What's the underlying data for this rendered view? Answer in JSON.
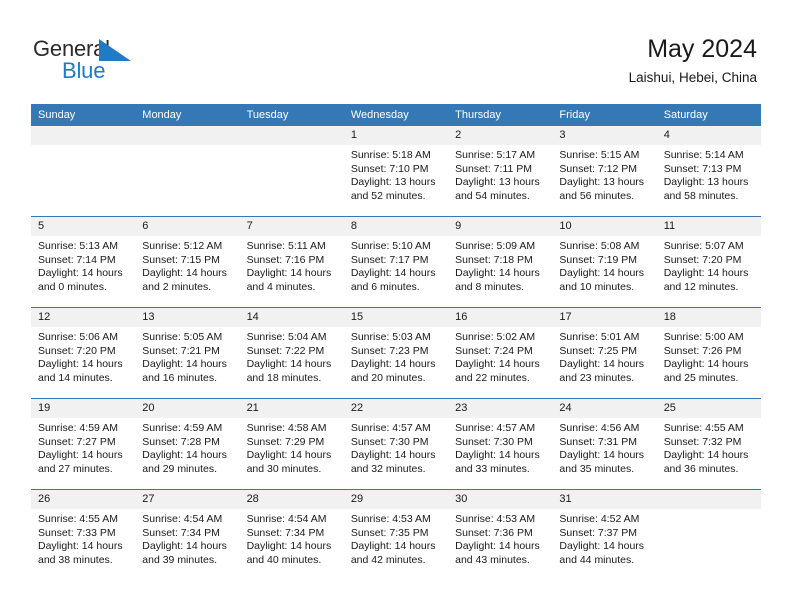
{
  "brand": {
    "name_part1": "General",
    "name_part2": "Blue",
    "triangle_color": "#1f7cc4",
    "text_color": "#2b2b2b"
  },
  "header": {
    "title": "May 2024",
    "subtitle": "Laishui, Hebei, China"
  },
  "theme": {
    "header_blue": "#3478b6",
    "daynum_band": "#f1f1f1",
    "text": "#1a1a1a"
  },
  "columns": [
    "Sunday",
    "Monday",
    "Tuesday",
    "Wednesday",
    "Thursday",
    "Friday",
    "Saturday"
  ],
  "weeks": [
    [
      {
        "day": "",
        "lines": []
      },
      {
        "day": "",
        "lines": []
      },
      {
        "day": "",
        "lines": []
      },
      {
        "day": "1",
        "lines": [
          "Sunrise: 5:18 AM",
          "Sunset: 7:10 PM",
          "Daylight: 13 hours and 52 minutes."
        ]
      },
      {
        "day": "2",
        "lines": [
          "Sunrise: 5:17 AM",
          "Sunset: 7:11 PM",
          "Daylight: 13 hours and 54 minutes."
        ]
      },
      {
        "day": "3",
        "lines": [
          "Sunrise: 5:15 AM",
          "Sunset: 7:12 PM",
          "Daylight: 13 hours and 56 minutes."
        ]
      },
      {
        "day": "4",
        "lines": [
          "Sunrise: 5:14 AM",
          "Sunset: 7:13 PM",
          "Daylight: 13 hours and 58 minutes."
        ]
      }
    ],
    [
      {
        "day": "5",
        "lines": [
          "Sunrise: 5:13 AM",
          "Sunset: 7:14 PM",
          "Daylight: 14 hours and 0 minutes."
        ]
      },
      {
        "day": "6",
        "lines": [
          "Sunrise: 5:12 AM",
          "Sunset: 7:15 PM",
          "Daylight: 14 hours and 2 minutes."
        ]
      },
      {
        "day": "7",
        "lines": [
          "Sunrise: 5:11 AM",
          "Sunset: 7:16 PM",
          "Daylight: 14 hours and 4 minutes."
        ]
      },
      {
        "day": "8",
        "lines": [
          "Sunrise: 5:10 AM",
          "Sunset: 7:17 PM",
          "Daylight: 14 hours and 6 minutes."
        ]
      },
      {
        "day": "9",
        "lines": [
          "Sunrise: 5:09 AM",
          "Sunset: 7:18 PM",
          "Daylight: 14 hours and 8 minutes."
        ]
      },
      {
        "day": "10",
        "lines": [
          "Sunrise: 5:08 AM",
          "Sunset: 7:19 PM",
          "Daylight: 14 hours and 10 minutes."
        ]
      },
      {
        "day": "11",
        "lines": [
          "Sunrise: 5:07 AM",
          "Sunset: 7:20 PM",
          "Daylight: 14 hours and 12 minutes."
        ]
      }
    ],
    [
      {
        "day": "12",
        "lines": [
          "Sunrise: 5:06 AM",
          "Sunset: 7:20 PM",
          "Daylight: 14 hours and 14 minutes."
        ]
      },
      {
        "day": "13",
        "lines": [
          "Sunrise: 5:05 AM",
          "Sunset: 7:21 PM",
          "Daylight: 14 hours and 16 minutes."
        ]
      },
      {
        "day": "14",
        "lines": [
          "Sunrise: 5:04 AM",
          "Sunset: 7:22 PM",
          "Daylight: 14 hours and 18 minutes."
        ]
      },
      {
        "day": "15",
        "lines": [
          "Sunrise: 5:03 AM",
          "Sunset: 7:23 PM",
          "Daylight: 14 hours and 20 minutes."
        ]
      },
      {
        "day": "16",
        "lines": [
          "Sunrise: 5:02 AM",
          "Sunset: 7:24 PM",
          "Daylight: 14 hours and 22 minutes."
        ]
      },
      {
        "day": "17",
        "lines": [
          "Sunrise: 5:01 AM",
          "Sunset: 7:25 PM",
          "Daylight: 14 hours and 23 minutes."
        ]
      },
      {
        "day": "18",
        "lines": [
          "Sunrise: 5:00 AM",
          "Sunset: 7:26 PM",
          "Daylight: 14 hours and 25 minutes."
        ]
      }
    ],
    [
      {
        "day": "19",
        "lines": [
          "Sunrise: 4:59 AM",
          "Sunset: 7:27 PM",
          "Daylight: 14 hours and 27 minutes."
        ]
      },
      {
        "day": "20",
        "lines": [
          "Sunrise: 4:59 AM",
          "Sunset: 7:28 PM",
          "Daylight: 14 hours and 29 minutes."
        ]
      },
      {
        "day": "21",
        "lines": [
          "Sunrise: 4:58 AM",
          "Sunset: 7:29 PM",
          "Daylight: 14 hours and 30 minutes."
        ]
      },
      {
        "day": "22",
        "lines": [
          "Sunrise: 4:57 AM",
          "Sunset: 7:30 PM",
          "Daylight: 14 hours and 32 minutes."
        ]
      },
      {
        "day": "23",
        "lines": [
          "Sunrise: 4:57 AM",
          "Sunset: 7:30 PM",
          "Daylight: 14 hours and 33 minutes."
        ]
      },
      {
        "day": "24",
        "lines": [
          "Sunrise: 4:56 AM",
          "Sunset: 7:31 PM",
          "Daylight: 14 hours and 35 minutes."
        ]
      },
      {
        "day": "25",
        "lines": [
          "Sunrise: 4:55 AM",
          "Sunset: 7:32 PM",
          "Daylight: 14 hours and 36 minutes."
        ]
      }
    ],
    [
      {
        "day": "26",
        "lines": [
          "Sunrise: 4:55 AM",
          "Sunset: 7:33 PM",
          "Daylight: 14 hours and 38 minutes."
        ]
      },
      {
        "day": "27",
        "lines": [
          "Sunrise: 4:54 AM",
          "Sunset: 7:34 PM",
          "Daylight: 14 hours and 39 minutes."
        ]
      },
      {
        "day": "28",
        "lines": [
          "Sunrise: 4:54 AM",
          "Sunset: 7:34 PM",
          "Daylight: 14 hours and 40 minutes."
        ]
      },
      {
        "day": "29",
        "lines": [
          "Sunrise: 4:53 AM",
          "Sunset: 7:35 PM",
          "Daylight: 14 hours and 42 minutes."
        ]
      },
      {
        "day": "30",
        "lines": [
          "Sunrise: 4:53 AM",
          "Sunset: 7:36 PM",
          "Daylight: 14 hours and 43 minutes."
        ]
      },
      {
        "day": "31",
        "lines": [
          "Sunrise: 4:52 AM",
          "Sunset: 7:37 PM",
          "Daylight: 14 hours and 44 minutes."
        ]
      },
      {
        "day": "",
        "lines": []
      }
    ]
  ]
}
